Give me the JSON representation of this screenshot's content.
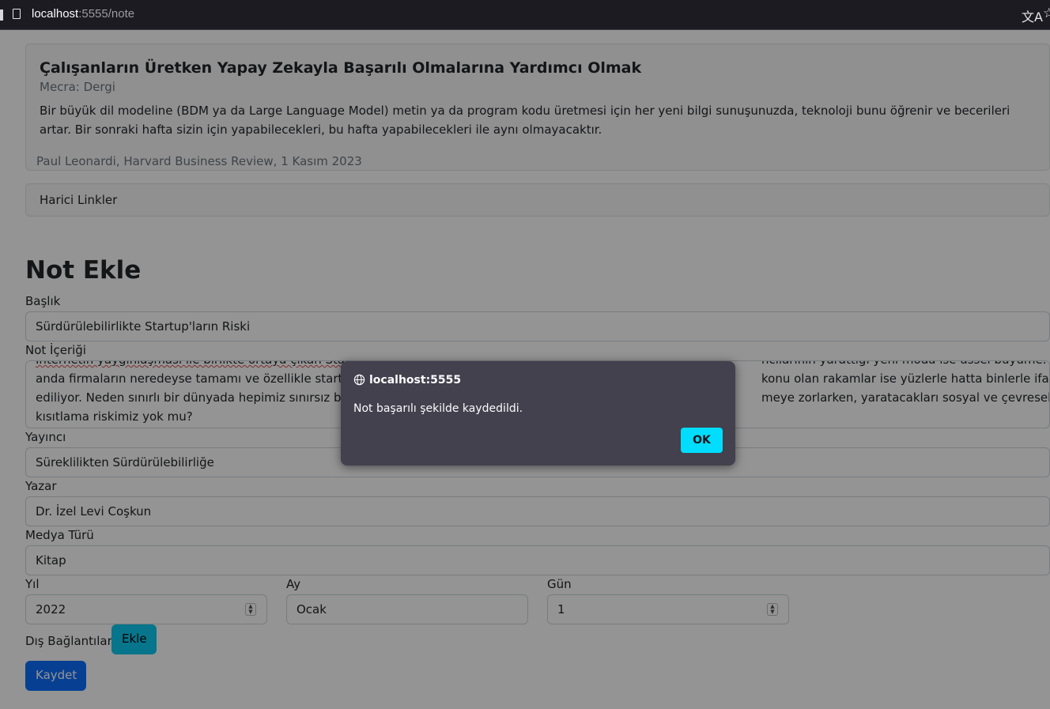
{
  "browser": {
    "url_host": "localhost",
    "url_rest": ":5555/note",
    "translate_icon": "translate-icon",
    "star_icon": "bookmark-star-icon"
  },
  "note_card": {
    "title": "Çalışanların Üretken Yapay Zekayla Başarılı Olmalarına Yardımcı Olmak",
    "medium": "Mecra: Dergi",
    "body": "Bir büyük dil modeline (BDM ya da Large Language Model) metin ya da program kodu üretmesi için her yeni bilgi sunuşunuzda, teknoloji bunu öğrenir ve becerileri artar. Bir sonraki hafta sizin için yapabilecekleri, bu hafta yapabilecekleri ile aynı olmayacaktır.",
    "footer": "Paul Leonardi, Harvard Business Review, 1 Kasım 2023"
  },
  "external_links_label": "Harici Linkler",
  "form": {
    "heading": "Not Ekle",
    "title_label": "Başlık",
    "title_value": "Sürdürülebilirlikte Startup'ların Riski",
    "content_label": "Not İçeriği",
    "content_lines": [
      "İnternetin yaygınlaşması ile birlikte ortaya çıkan Startup",
      "anda firmaların neredeyse tamamı ve özellikle startup",
      "ediliyor. Neden sınırlı bir dünyada hepimiz sınırsız bir b",
      "kısıtlama riskimiz yok mu?"
    ],
    "content_right_lines": [
      "ncılarının yarattığı yeni moda ise üssel büyüme. Şu",
      "konu olan rakamlar ise yüzlerle hatta binlerle ifade",
      "meye zorlarken, yaratacakları sosyal ve çevresel etkiyi"
    ],
    "publisher_label": "Yayıncı",
    "publisher_value": "Süreklilikten Sürdürülebilirliğe",
    "author_label": "Yazar",
    "author_value": "Dr. İzel Levi Coşkun",
    "media_label": "Medya Türü",
    "media_value": "Kitap",
    "year_label": "Yıl",
    "year_value": "2022",
    "month_label": "Ay",
    "month_value": "Ocak",
    "day_label": "Gün",
    "day_value": "1",
    "links_label": "Dış Bağlantılar",
    "add_button": "Ekle",
    "save_button": "Kaydet"
  },
  "dialog": {
    "host": "localhost:5555",
    "message": "Not başarılı şekilde kaydedildi.",
    "ok_button": "OK"
  },
  "colors": {
    "primary": "#0d6efd",
    "info": "#0dcaf0",
    "dialog_bg": "#42414d",
    "dialog_ok": "#00ddff"
  }
}
